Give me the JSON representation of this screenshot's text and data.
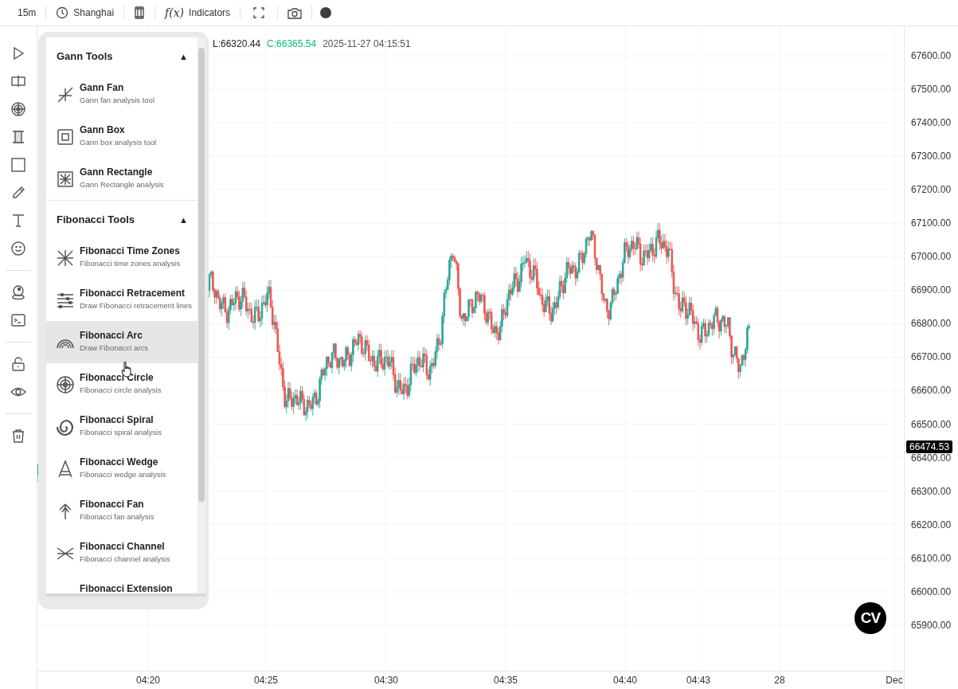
{
  "toolbar": {
    "interval": "15m",
    "timezone": "Shanghai",
    "indicators_icon": "f(x)",
    "indicators": "Indicators"
  },
  "legend": {
    "low": "L:66320.44",
    "close": "C:66365.54",
    "time": "2025-11-27 04:15:51"
  },
  "price_axis": {
    "labels": [
      "67600.00",
      "67500.00",
      "67400.00",
      "67300.00",
      "67200.00",
      "67100.00",
      "67000.00",
      "66900.00",
      "66800.00",
      "66700.00",
      "66600.00",
      "66500.00",
      "66400.00",
      "66300.00",
      "66200.00",
      "66100.00",
      "66000.00",
      "65900.00"
    ],
    "current_price": "66474.53"
  },
  "time_axis": {
    "labels": [
      "04:20",
      "04:25",
      "04:30",
      "04:35",
      "04:40",
      "04:43",
      "28",
      "Dec"
    ]
  },
  "logo": "CV",
  "tool_menu": {
    "sections": [
      {
        "title": "Gann Tools",
        "toggle": "▲",
        "expanded": true,
        "items": [
          {
            "kind": "fan",
            "name": "Gann Fan",
            "description": "Gann fan analysis tool",
            "selected": false
          },
          {
            "kind": "box",
            "name": "Gann Box",
            "description": "Gann box analysis tool",
            "selected": false
          },
          {
            "kind": "rect",
            "name": "Gann Rectangle",
            "description": "Gann Rectangle analysis",
            "selected": false
          }
        ]
      },
      {
        "title": "Fibonacci Tools",
        "toggle": "▲",
        "expanded": true,
        "items": [
          {
            "kind": "zones",
            "name": "Fibonacci Time Zones",
            "description": "Fibonacci time zones analysis",
            "selected": false
          },
          {
            "kind": "retracement",
            "name": "Fibonacci Retracement",
            "description": "Draw Fibonacci retracement lines",
            "selected": false
          },
          {
            "kind": "arc",
            "name": "Fibonacci Arc",
            "description": "Draw Fibonacci arcs",
            "selected": true
          },
          {
            "kind": "circle",
            "name": "Fibonacci Circle",
            "description": "Fibonacci circle analysis",
            "selected": false
          },
          {
            "kind": "spiral",
            "name": "Fibonacci Spiral",
            "description": "Fibonacci spiral analysis",
            "selected": false
          },
          {
            "kind": "wedge",
            "name": "Fibonacci Wedge",
            "description": "Fibonacci wedge analysis",
            "selected": false
          },
          {
            "kind": "fibfan",
            "name": "Fibonacci Fan",
            "description": "Fibonacci fan analysis",
            "selected": false
          },
          {
            "kind": "channel",
            "name": "Fibonacci Channel",
            "description": "Fibonacci channel analysis",
            "selected": false
          },
          {
            "kind": "none",
            "name": "Fibonacci Extension",
            "selected": false
          }
        ]
      }
    ]
  }
}
